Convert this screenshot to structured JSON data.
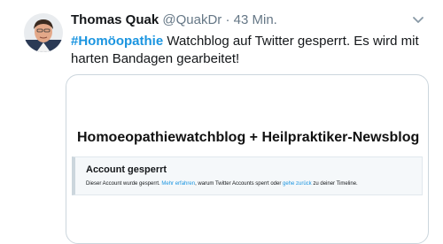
{
  "tweet": {
    "author_name": "Thomas Quak",
    "author_handle": "@QuakDr",
    "separator": "·",
    "timestamp": "43 Min.",
    "hashtag": "#Homöopathie",
    "text_rest": " Watchblog auf Twitter gesperrt. Es wird mit harten Bandagen gearbeitet!",
    "menu_icon": "chevron-down-icon",
    "avatar_icon": "avatar",
    "colors": {
      "accent": "#1b95e0",
      "name": "#14171a",
      "secondary": "#657786",
      "card_border": "#ccd6dd"
    }
  },
  "card": {
    "title": "Homoeopathiewatchblog + Heilpraktiker-Newsblog",
    "notice": {
      "title": "Account gesperrt",
      "text_before_link1": "Dieser Account wurde gesperrt. ",
      "link1": "Mehr erfahren",
      "text_between": ", warum Twitter Accounts sperrt oder ",
      "link2": "gehe zurück",
      "text_after": " zu deiner Timeline."
    }
  }
}
